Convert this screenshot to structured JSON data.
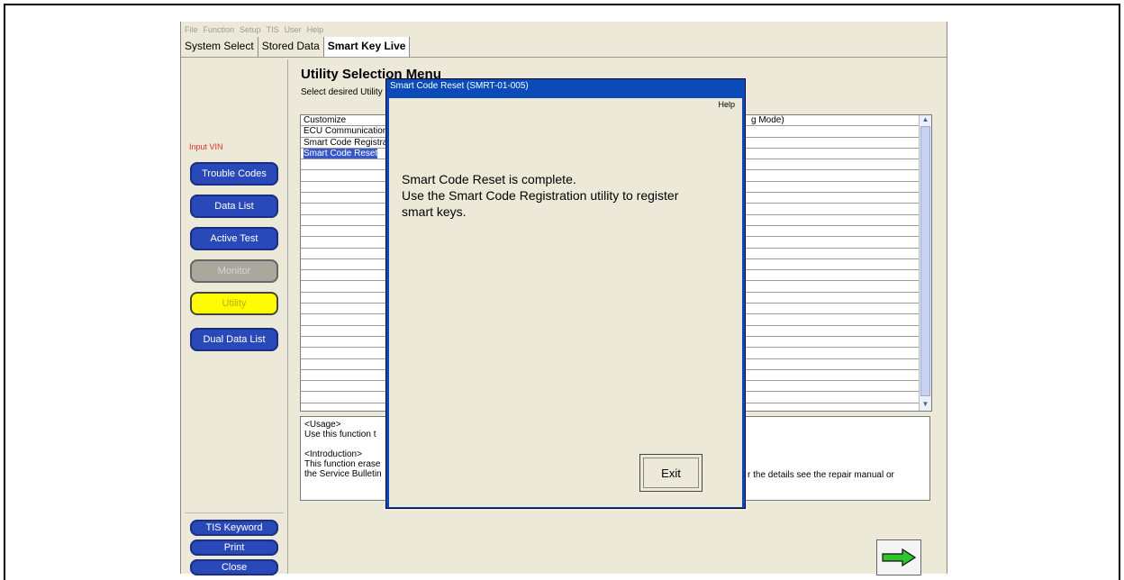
{
  "menu": [
    "File",
    "Function",
    "Setup",
    "TIS",
    "User",
    "Help"
  ],
  "tabs": [
    "System Select",
    "Stored Data",
    "Smart Key Live"
  ],
  "sidebar": {
    "input_vin": "Input VIN",
    "buttons": [
      "Trouble Codes",
      "Data List",
      "Active Test",
      "Monitor",
      "Utility",
      "Dual Data List"
    ],
    "bottom_buttons": [
      "TIS Keyword",
      "Print",
      "Close"
    ]
  },
  "main": {
    "title": "Utility Selection Menu",
    "subtitle": "Select desired Utility",
    "list_items": [
      "Customize",
      "ECU Communication",
      "Smart Code Registration",
      "Smart Code Reset"
    ],
    "list_right": "g Mode)",
    "usage_lines": [
      "<Usage>",
      "Use this function t",
      "",
      "<Introduction>",
      "This function erase",
      "the Service Bulletin"
    ],
    "usage_right": "r the details see the repair manual or"
  },
  "dialog": {
    "title": "Smart Code Reset (SMRT-01-005)",
    "help": "Help",
    "message": [
      "Smart Code Reset is complete.",
      "Use the Smart Code Registration utility to register",
      "smart keys."
    ],
    "exit": "Exit"
  }
}
